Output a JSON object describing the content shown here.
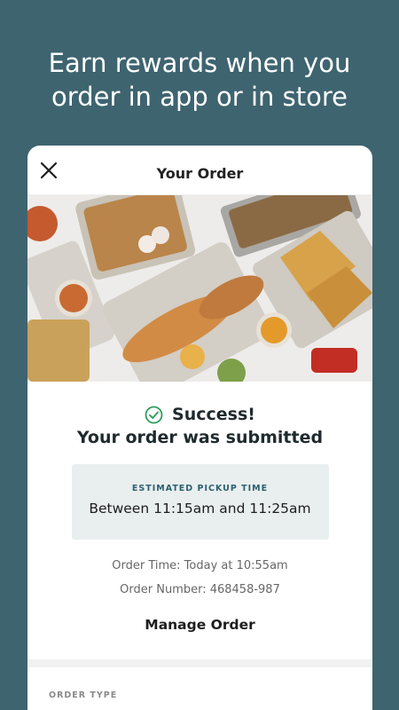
{
  "promo": {
    "headline_line1": "Earn rewards when you",
    "headline_line2": "order in app or in store"
  },
  "header": {
    "title": "Your Order",
    "close_icon": "close-icon"
  },
  "confirmation": {
    "status": "Success!",
    "message": "Your order was submitted",
    "status_icon": "check-circle-icon"
  },
  "pickup": {
    "label": "ESTIMATED PICKUP TIME",
    "window": "Between 11:15am and 11:25am"
  },
  "details": {
    "order_time": "Order Time: Today at 10:55am",
    "order_number": "Order Number: 468458-987"
  },
  "actions": {
    "manage_label": "Manage Order"
  },
  "sections": {
    "order_type_label": "ORDER TYPE"
  },
  "colors": {
    "background": "#3e6470",
    "accent": "#2a6070",
    "success": "#2e9e5e"
  }
}
